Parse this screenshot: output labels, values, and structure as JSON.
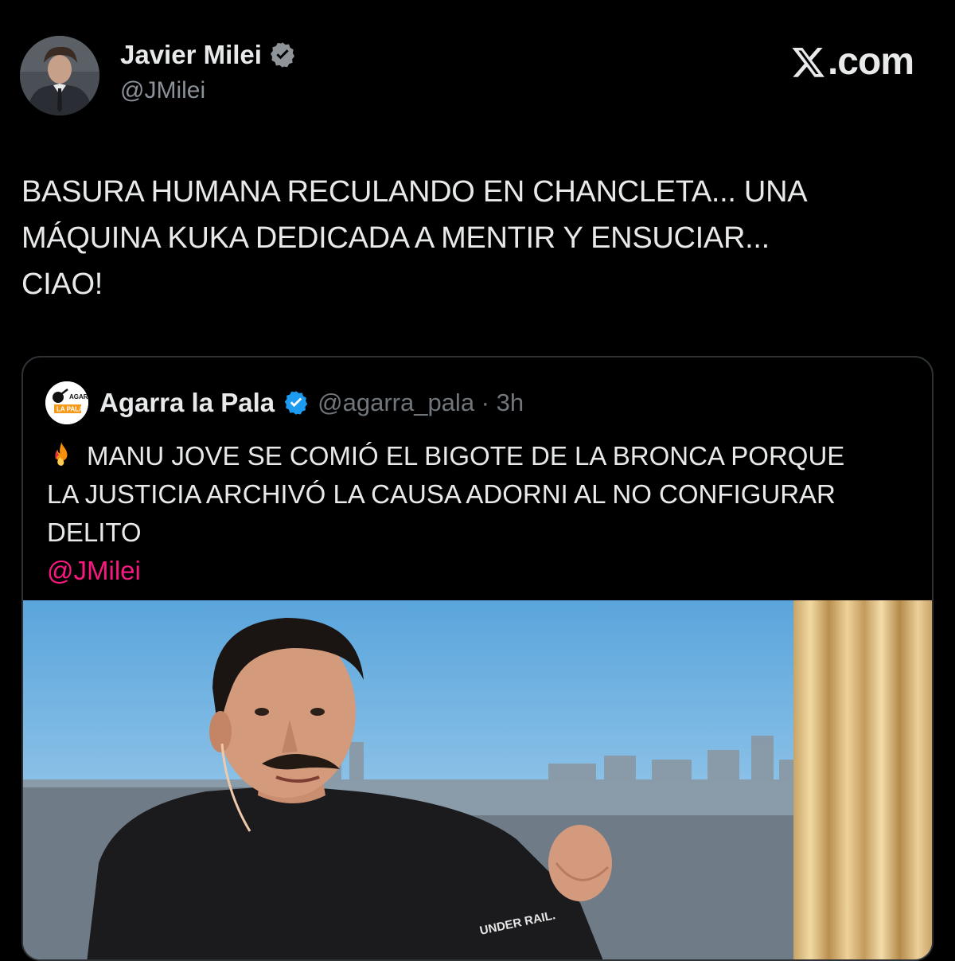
{
  "author": {
    "name": "Javier Milei",
    "handle": "@JMilei",
    "verified": true,
    "verified_color": "#1d9bf0"
  },
  "brand": {
    "label": ".com"
  },
  "tweet": {
    "lines": [
      "BASURA HUMANA RECULANDO EN CHANCLETA... UNA",
      "MÁQUINA KUKA DEDICADA A MENTIR Y ENSUCIAR...",
      "CIAO!"
    ]
  },
  "quoted_tweet": {
    "author_name": "Agarra la Pala",
    "handle_time": "@agarra_pala · 3h",
    "verified": true,
    "logo_text": [
      "AGARRÁ",
      "LA PALA"
    ],
    "emoji": "fire-emoji",
    "lines": [
      "MANU JOVE SE COMIÓ EL BIGOTE DE LA BRONCA PORQUE",
      "LA JUSTICIA ARCHIVÓ LA CAUSA ADORNI AL NO CONFIGURAR",
      "DELITO"
    ],
    "mention": "@JMilei",
    "mention_color": "#f91880",
    "media": {
      "shirt_text": "UNDER RAIL."
    }
  }
}
